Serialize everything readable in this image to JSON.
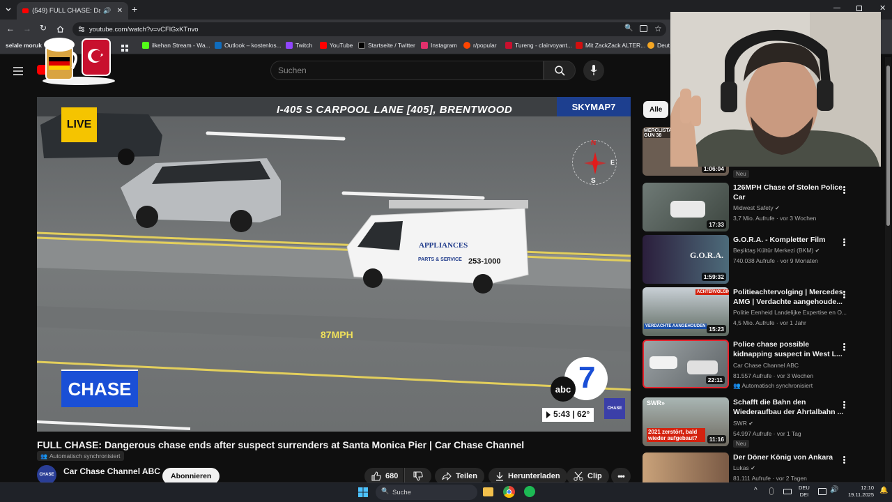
{
  "browser": {
    "tab_title": "(549) FULL CHASE: Dangerou",
    "url": "youtube.com/watch?v=vCFlGxKTnvo",
    "bookmarks": [
      {
        "label": "selale moruk",
        "color": "#e8eaed"
      },
      {
        "label": "ilkehan Stream - Wa...",
        "color": "#53fc18"
      },
      {
        "label": "Outlook – kostenlos...",
        "color": "#0f6cbd"
      },
      {
        "label": "Twitch",
        "color": "#9146ff"
      },
      {
        "label": "YouTube",
        "color": "#ff0000"
      },
      {
        "label": "Startseite / Twitter",
        "color": "#000000"
      },
      {
        "label": "Instagram",
        "color": "#e1306c"
      },
      {
        "label": "r/popular",
        "color": "#ff4500"
      },
      {
        "label": "Tureng - clairvoyant...",
        "color": "#c8102e"
      },
      {
        "label": "Mit ZackZack ALTER...",
        "color": "#d20f0f"
      },
      {
        "label": "Deut",
        "color": "#f5a623"
      }
    ]
  },
  "youtube": {
    "search_placeholder": "Suchen",
    "video": {
      "overlay_location": "I-405 S CARPOOL LANE [405], BRENTWOOD",
      "overlay_brand": "SKYMAP7",
      "live_label": "LIVE",
      "chase_label": "CHASE",
      "speed": "87MPH",
      "time_temp": "5:43 | 62°",
      "van_text": "APPLIANCES",
      "van_sub": "PARTS & SERVICE",
      "van_phone": "253-1000",
      "compass": {
        "n": "N",
        "s": "S",
        "e": "E"
      },
      "abc_label": "abc",
      "corner_badge": "CHASE"
    },
    "title": "FULL CHASE: Dangerous chase ends after suspect surrenders at Santa Monica Pier | Car Chase Channel",
    "auto_sync": "Automatisch synchronisiert",
    "channel": {
      "name": "Car Chase Channel ABC",
      "subscribe": "Abonnieren",
      "avatar_text": "CHASE"
    },
    "actions": {
      "likes": "680",
      "share": "Teilen",
      "download": "Herunterladen",
      "clip": "Clip"
    },
    "filter_chip": "Alle",
    "recommendations": [
      {
        "title": "",
        "channel": "",
        "meta": "",
        "duration": "1:06:04",
        "badge": "Neu",
        "thumb_text": "MERCLISTAN GUN 38"
      },
      {
        "title": "126MPH Chase of Stolen Police Car",
        "channel": "Midwest Safety",
        "meta": "3,7 Mio. Aufrufe · vor 3 Wochen",
        "duration": "17:33",
        "badge": ""
      },
      {
        "title": "G.O.R.A. - Kompletter Film",
        "channel": "Beşiktaş Kültür Merkezi (BKM)",
        "meta": "740.038 Aufrufe · vor 9 Monaten",
        "duration": "1:59:32",
        "badge": "",
        "thumb_text": "G.O.R.A."
      },
      {
        "title": "Politieachtervolging | Mercedes AMG | Verdachte aangehoude...",
        "channel": "Politie Eenheid Landelijke Expertise en O...",
        "meta": "4,5 Mio. Aufrufe · vor 1 Jahr",
        "duration": "15:23",
        "badge": "",
        "thumb_text": "VERDACHTE AANGEHOUDEN",
        "thumb_top": "ACHTERVOLGING"
      },
      {
        "title": "Police chase possible kidnapping suspect in West L...",
        "channel": "Car Chase Channel ABC",
        "meta": "81.557 Aufrufe · vor 3 Wochen",
        "duration": "22:11",
        "badge": "",
        "sync": "Automatisch synchronisiert"
      },
      {
        "title": "Schafft die Bahn den Wiederaufbau der Ahrtalbahn ...",
        "channel": "SWR",
        "meta": "54.997 Aufrufe · vor 1 Tag",
        "duration": "11:16",
        "badge": "Neu",
        "thumb_text": "2021 zerstört, bald wieder aufgebaut?",
        "thumb_top": "SWR»"
      },
      {
        "title": "Der Döner König von Ankara",
        "channel": "Lukas",
        "meta": "81.111 Aufrufe · vor 2 Tagen",
        "duration": "",
        "badge": ""
      }
    ]
  },
  "taskbar": {
    "search": "Suche",
    "lang_top": "DEU",
    "lang_bottom": "DEI",
    "time": "12:10",
    "date": "19.11.2025"
  },
  "colors": {
    "yt_red": "#ff0000",
    "accent_bg": "#0f0f0f",
    "chase_blue": "#1a4fd6",
    "live_yellow": "#f5c400"
  }
}
